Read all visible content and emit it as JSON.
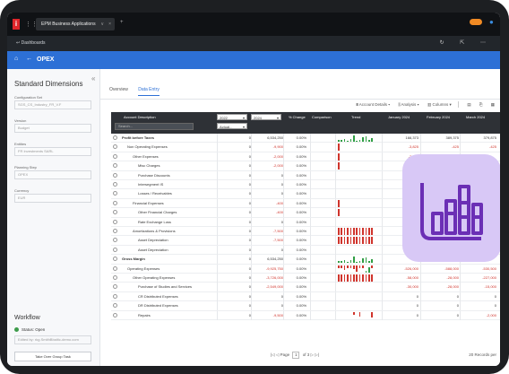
{
  "window": {
    "tab_title": "EPM Business Applications",
    "tab_dropdown": "∨",
    "tab_close": "×",
    "new_tab": "+",
    "logo_letter": "i",
    "grid_glyph": "⋮⋮⋮"
  },
  "nav": {
    "back_label": "Dashboards",
    "icons": "↻ ⇱ ⋯"
  },
  "header": {
    "title": "OPEX"
  },
  "sidebar": {
    "title": "Standard Dimensions",
    "collapse_glyph": "«",
    "fields": [
      {
        "label": "Configuration Set",
        "value": "SGS_CS_Industry_FR_V.F"
      },
      {
        "label": "Version",
        "value": "Budget"
      },
      {
        "label": "Entities",
        "value": "FR Investments SARL"
      },
      {
        "label": "Planning Step",
        "value": "OPEX"
      },
      {
        "label": "Currency",
        "value": "EUR"
      }
    ],
    "workflow_title": "Workflow",
    "status": "Status: Open",
    "edited_by": "Edited by: rkg.SmithBbaltic-demo.com",
    "take_over": "Take Over Group Task"
  },
  "main": {
    "tabs": [
      {
        "label": "Overview",
        "active": false
      },
      {
        "label": "Data Entry",
        "active": true
      }
    ],
    "toolbar": {
      "account_details": "Account Details",
      "analysis": "Analysis",
      "columns": "Columns"
    },
    "grid": {
      "header": {
        "account_description": "Account Description",
        "search_placeholder": "Search...",
        "year1": "2022",
        "year2": "2024",
        "actual": "Actual...",
        "pct_change": "% Change",
        "comparison": "Comparison",
        "trend": "Trend",
        "months": [
          "January 2024",
          "February 2024",
          "March 2024"
        ]
      },
      "rows": [
        {
          "desc": "Profit before Taxes",
          "indent": 0,
          "bold": true,
          "v1": "0",
          "v2": "6,534,250",
          "pct": "0.00%",
          "m1": "166,373",
          "m2": "389,375",
          "m3": "379,875",
          "neg": false,
          "trend": "mixed"
        },
        {
          "desc": "Non Operating Expenses",
          "indent": 1,
          "bold": false,
          "v1": "0",
          "v2": "-9,900",
          "pct": "0.00%",
          "m1": "-3,825",
          "m2": "-425",
          "m3": "-425",
          "neg": true,
          "trend": "spike"
        },
        {
          "desc": "Other Expenses",
          "indent": 2,
          "bold": false,
          "v1": "0",
          "v2": "-2,000",
          "pct": "0.00%",
          "m1": "-2,000",
          "m2": "",
          "m3": "",
          "neg": true,
          "trend": "spike"
        },
        {
          "desc": "Misc Charges",
          "indent": 3,
          "bold": false,
          "v1": "0",
          "v2": "-2,000",
          "pct": "0.00%",
          "m1": "",
          "m2": "",
          "m3": "",
          "neg": true,
          "trend": "spike"
        },
        {
          "desc": "Purchase Discounts",
          "indent": 3,
          "bold": false,
          "v1": "0",
          "v2": "0",
          "pct": "0.00%",
          "m1": "",
          "m2": "",
          "m3": "",
          "neg": false,
          "trend": "none"
        },
        {
          "desc": "Intersegment IS",
          "indent": 3,
          "bold": false,
          "v1": "0",
          "v2": "0",
          "pct": "0.00%",
          "m1": "",
          "m2": "",
          "m3": "",
          "neg": false,
          "trend": "none"
        },
        {
          "desc": "Losses / Receivables",
          "indent": 3,
          "bold": false,
          "v1": "0",
          "v2": "0",
          "pct": "0.00%",
          "m1": "",
          "m2": "",
          "m3": "",
          "neg": false,
          "trend": "none"
        },
        {
          "desc": "Financial Expenses",
          "indent": 2,
          "bold": false,
          "v1": "0",
          "v2": "-400",
          "pct": "0.00%",
          "m1": "",
          "m2": "",
          "m3": "",
          "neg": true,
          "trend": "spike"
        },
        {
          "desc": "Other Financial Charges",
          "indent": 3,
          "bold": false,
          "v1": "0",
          "v2": "-400",
          "pct": "0.00%",
          "m1": "",
          "m2": "",
          "m3": "",
          "neg": true,
          "trend": "spike"
        },
        {
          "desc": "Rate Exchange Loss",
          "indent": 3,
          "bold": false,
          "v1": "0",
          "v2": "0",
          "pct": "0.00%",
          "m1": "",
          "m2": "",
          "m3": "",
          "neg": false,
          "trend": "none"
        },
        {
          "desc": "Amortizations & Provisions",
          "indent": 2,
          "bold": false,
          "v1": "0",
          "v2": "-7,500",
          "pct": "0.00%",
          "m1": "",
          "m2": "",
          "m3": "",
          "neg": true,
          "trend": "full"
        },
        {
          "desc": "Asset Depreciation",
          "indent": 3,
          "bold": false,
          "v1": "0",
          "v2": "-7,500",
          "pct": "0.00%",
          "m1": "",
          "m2": "",
          "m3": "",
          "neg": true,
          "trend": "full"
        },
        {
          "desc": "Asset Depreciation",
          "indent": 3,
          "bold": false,
          "v1": "0",
          "v2": "0",
          "pct": "0.00%",
          "m1": "",
          "m2": "",
          "m3": "",
          "neg": false,
          "trend": "none"
        },
        {
          "desc": "Gross Margin",
          "indent": 0,
          "bold": true,
          "v1": "0",
          "v2": "6,534,250",
          "pct": "0.00%",
          "m1": "170,",
          "m2": "",
          "m3": "",
          "neg": false,
          "trend": "mixed"
        },
        {
          "desc": "Operating Expenses",
          "indent": 1,
          "bold": false,
          "v1": "0",
          "v2": "-9,925,750",
          "pct": "0.00%",
          "m1": "-526,000",
          "m2": "-588,000",
          "m3": "-530,500",
          "neg": true,
          "trend": "mixed2"
        },
        {
          "desc": "Other Operating Expenses",
          "indent": 2,
          "bold": false,
          "v1": "0",
          "v2": "-3,726,000",
          "pct": "0.00%",
          "m1": "-58,000",
          "m2": "-28,000",
          "m3": "-227,000",
          "neg": true,
          "trend": "full"
        },
        {
          "desc": "Purchase of Studies and Services",
          "indent": 3,
          "bold": false,
          "v1": "0",
          "v2": "-2,549,000",
          "pct": "0.00%",
          "m1": "-30,000",
          "m2": "-28,000",
          "m3": "-15,000",
          "neg": true,
          "trend": "none"
        },
        {
          "desc": "CR Distributed Expenses",
          "indent": 3,
          "bold": false,
          "v1": "0",
          "v2": "0",
          "pct": "0.00%",
          "m1": "0",
          "m2": "0",
          "m3": "0",
          "neg": false,
          "trend": "none"
        },
        {
          "desc": "DR Distributed Expenses",
          "indent": 3,
          "bold": false,
          "v1": "0",
          "v2": "0",
          "pct": "0.00%",
          "m1": "0",
          "m2": "0",
          "m3": "0",
          "neg": false,
          "trend": "none"
        },
        {
          "desc": "Repairs",
          "indent": 3,
          "bold": false,
          "v1": "0",
          "v2": "-9,500",
          "pct": "0.00%",
          "m1": "0",
          "m2": "0",
          "m3": "-2,000",
          "neg": true,
          "trend": "sparse"
        }
      ]
    },
    "pager": {
      "page_label": "Page",
      "page_value": "1",
      "of_label": "of 3",
      "records": "20 Records per"
    }
  },
  "colors": {
    "header_blue": "#2d70d6",
    "positive": "#2f9e44",
    "negative": "#d0342c",
    "overlay": "#d8c8f6",
    "overlay_icon": "#6b2fb5"
  }
}
